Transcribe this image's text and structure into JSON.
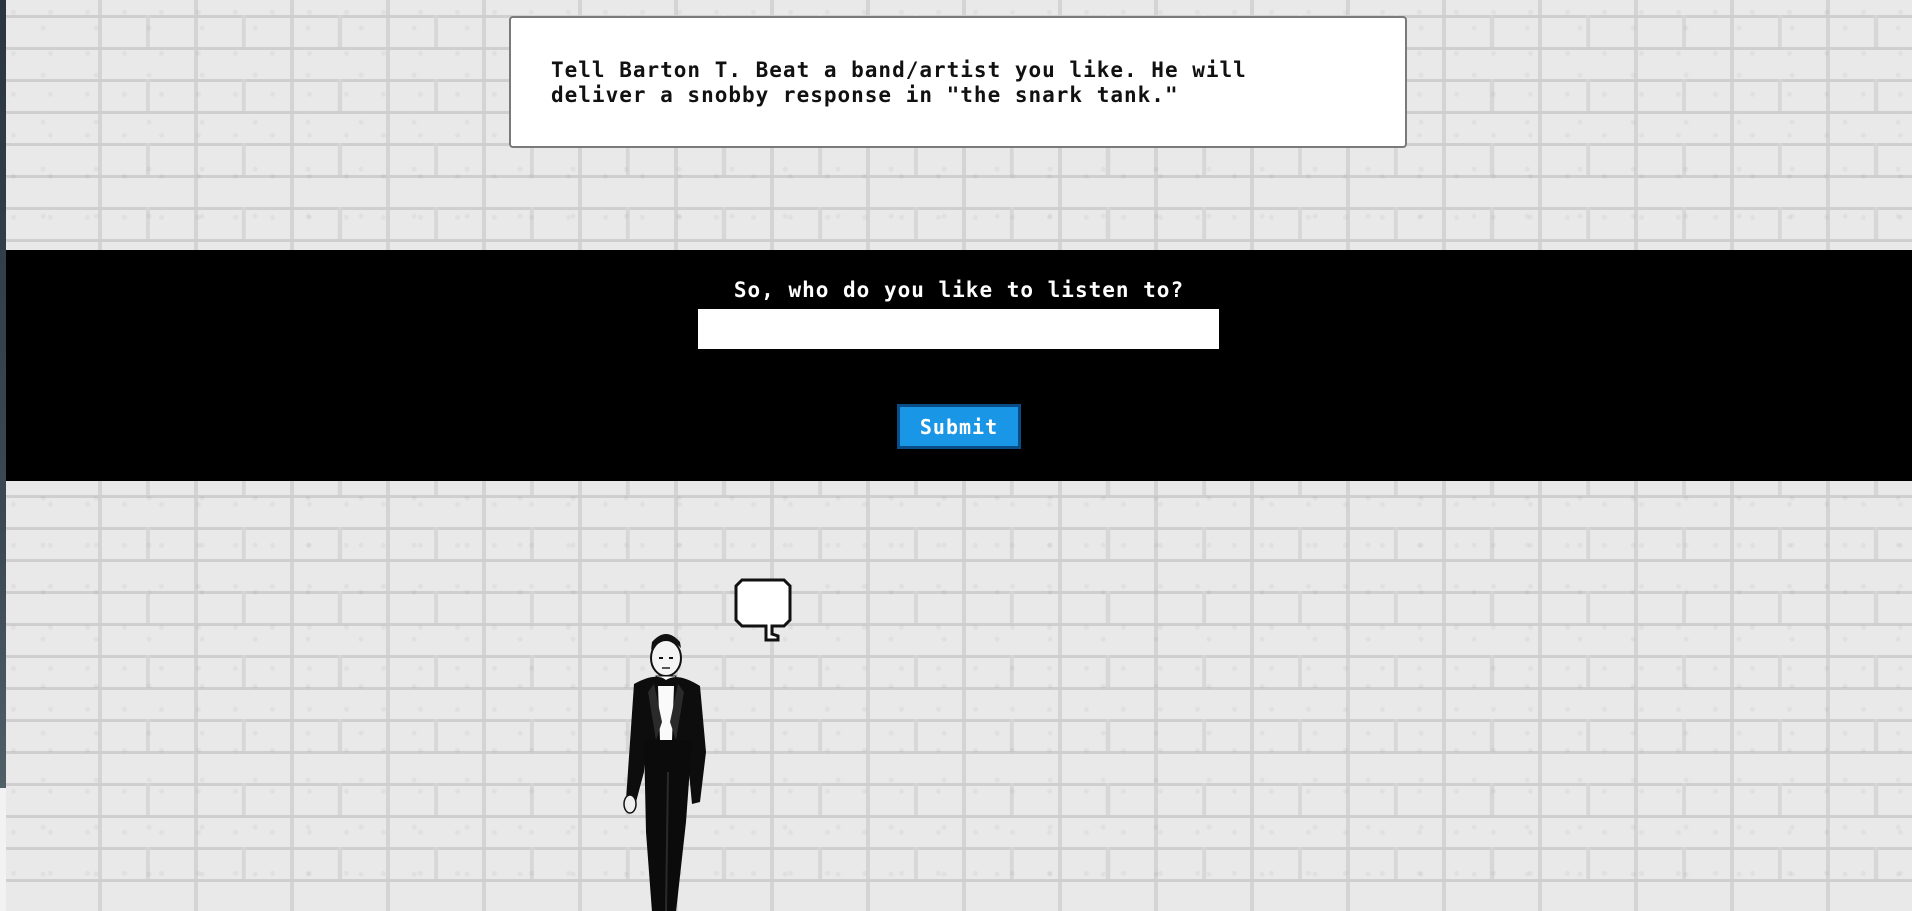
{
  "intro": {
    "text": "Tell Barton T. Beat a band/artist you like. He will\ndeliver a snobby response in \"the snark tank.\""
  },
  "form": {
    "question": "So, who do you like to listen to?",
    "input_value": "",
    "input_placeholder": "",
    "submit_label": "Submit"
  },
  "colors": {
    "band": "#000000",
    "button": "#1a96e6",
    "button_border": "#0a4c86",
    "wall": "#e9e9e9"
  },
  "icons": {
    "bubble": "speech-bubble-icon",
    "figure": "barton-figure"
  }
}
